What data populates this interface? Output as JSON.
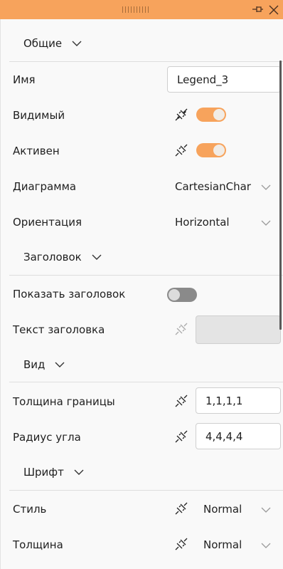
{
  "panel": {
    "sections": {
      "general": "Общие",
      "header": "Заголовок",
      "view": "Вид",
      "font": "Шрифт"
    },
    "props": {
      "name": {
        "label": "Имя",
        "value": "Legend_3"
      },
      "visible": {
        "label": "Видимый",
        "on": true
      },
      "active": {
        "label": "Активен",
        "on": true
      },
      "chart": {
        "label": "Диаграмма",
        "value": "CartesianChar"
      },
      "orientation": {
        "label": "Ориентация",
        "value": "Horizontal"
      },
      "show_header": {
        "label": "Показать заголовок",
        "on": false
      },
      "header_text": {
        "label": "Текст заголовка",
        "value": ""
      },
      "border_thickness": {
        "label": "Толщина границы",
        "value": "1,1,1,1"
      },
      "corner_radius": {
        "label": "Радиус угла",
        "value": "4,4,4,4"
      },
      "style": {
        "label": "Стиль",
        "value": "Normal"
      },
      "weight": {
        "label": "Толщина",
        "value": "Normal"
      }
    },
    "colors": {
      "accent": "#f7a35c",
      "toggle_off": "#8a8a8a"
    }
  }
}
